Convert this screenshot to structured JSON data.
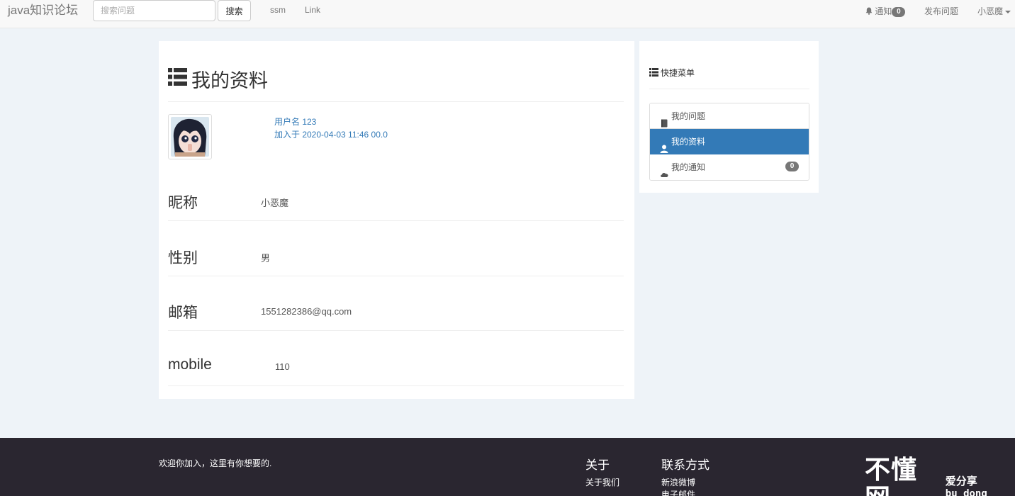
{
  "navbar": {
    "brand": "java知识论坛",
    "search_placeholder": "搜索问题",
    "search_button": "搜索",
    "links": [
      "ssm",
      "Link"
    ],
    "notify_label": "通知",
    "notify_count": "0",
    "publish_label": "发布问题",
    "user_label": "小恶魔"
  },
  "profile": {
    "title": "我的资料",
    "username": "用户名 123",
    "joined": "加入于 2020-04-03 11:46 00.0",
    "fields": [
      {
        "label": "昵称",
        "value": "小恶魔"
      },
      {
        "label": "性别",
        "value": "男"
      },
      {
        "label": "邮箱",
        "value": "1551282386@qq.com"
      },
      {
        "label": "mobile",
        "value": "110"
      }
    ]
  },
  "sidebar": {
    "title": "快捷菜单",
    "items": [
      {
        "label": "我的问题",
        "icon": "book-icon"
      },
      {
        "label": "我的资料",
        "icon": "user-icon",
        "active": true
      },
      {
        "label": "我的通知",
        "icon": "cloud-icon",
        "badge": "0"
      }
    ]
  },
  "footer": {
    "welcome": "欢迎你加入，这里有你想要的.",
    "about_head": "关于",
    "about_link": "关于我们",
    "contact_head": "联系方式",
    "contact_links": [
      "新浪微博",
      "电子邮件"
    ]
  },
  "watermark": {
    "big": "不懂网",
    "small": "爱分享",
    "pinyin": "bu dong wang"
  },
  "colors": {
    "accent": "#337ab7",
    "page_bg": "#eef3f8",
    "footer_bg": "#2a2630",
    "badge": "#777777"
  }
}
